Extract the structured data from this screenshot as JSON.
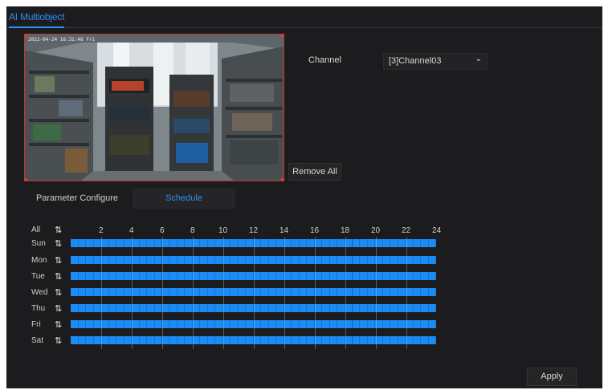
{
  "tab": {
    "label": "AI Multiobject"
  },
  "preview": {
    "osd_text": "2022-04-24 16:31:48 Fri"
  },
  "form": {
    "channel_label": "Channel",
    "channel_value": "[3]Channel03",
    "remove_all_label": "Remove All"
  },
  "subtabs": [
    {
      "label": "Parameter Configure",
      "active": false
    },
    {
      "label": "Schedule",
      "active": true
    }
  ],
  "schedule": {
    "all_label": "All",
    "hours": [
      "2",
      "4",
      "6",
      "8",
      "10",
      "12",
      "14",
      "16",
      "18",
      "20",
      "22",
      "24"
    ],
    "days": [
      "Sun",
      "Mon",
      "Tue",
      "Wed",
      "Thu",
      "Fri",
      "Sat"
    ],
    "selected_hours": {
      "Sun": "0-24",
      "Mon": "0-24",
      "Tue": "0-24",
      "Wed": "0-24",
      "Thu": "0-24",
      "Fri": "0-24",
      "Sat": "0-24"
    }
  },
  "footer": {
    "apply_label": "Apply"
  },
  "colors": {
    "accent": "#2e8ff0",
    "schedule_fill": "#1b8cf5",
    "panel_bg": "#1c1c1e",
    "preview_border": "#c0392b"
  },
  "icons": {
    "sync": "sync-arrows-icon",
    "dropdown": "chevron-down-icon"
  }
}
